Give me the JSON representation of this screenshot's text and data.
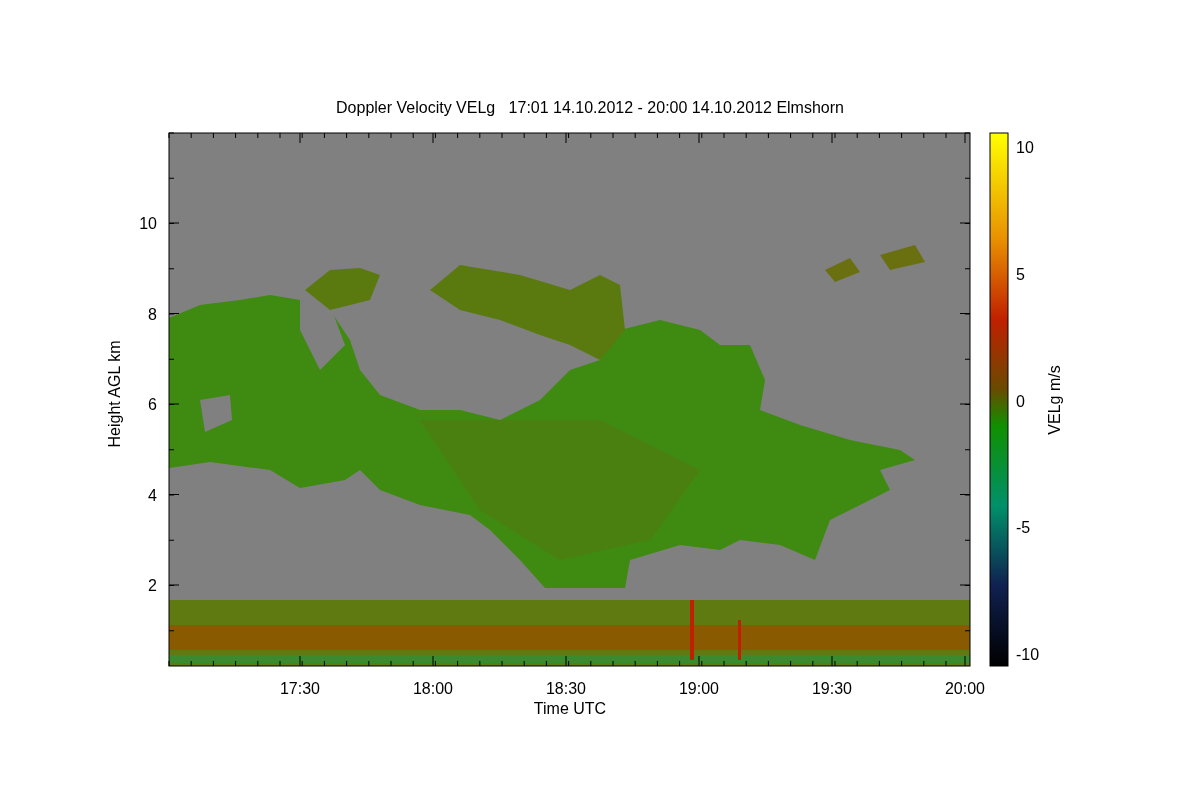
{
  "title": "Doppler Velocity VELg   17:01 14.10.2012 - 20:00 14.10.2012 Elmshorn",
  "xlabel": "Time UTC",
  "ylabel": "Height AGL km",
  "xticks": [
    "17:30",
    "18:00",
    "18:30",
    "19:00",
    "19:30",
    "20:00"
  ],
  "yticks": [
    "10",
    "8",
    "6",
    "4",
    "2"
  ],
  "colorbar": {
    "label": "VELg m/s",
    "ticks": [
      "10",
      "5",
      "0",
      "-5",
      "-10"
    ]
  }
}
